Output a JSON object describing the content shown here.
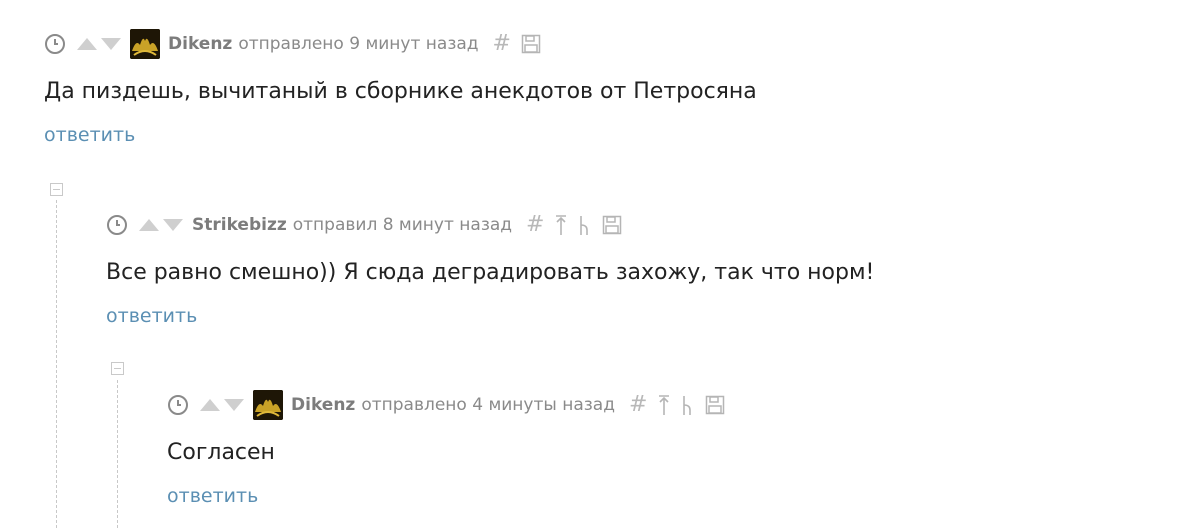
{
  "comments": [
    {
      "author": "Dikenz",
      "meta": "отправлено 9 минут назад",
      "text": "Да пиздешь, вычитаный в сборнике анекдотов от Петросяна",
      "reply": "ответить",
      "has_avatar": true,
      "icons": [
        "clock-icon",
        "upvote-icon",
        "downvote-icon",
        "hash-icon",
        "save-icon"
      ]
    },
    {
      "author": "Strikebizz",
      "meta": "отправил 8 минут назад",
      "text": "Все равно смешно)) Я сюда деградировать захожу, так что норм!",
      "reply": "ответить",
      "has_avatar": false,
      "icons": [
        "clock-icon",
        "upvote-icon",
        "downvote-icon",
        "hash-icon",
        "parent-icon",
        "thread-icon",
        "save-icon"
      ]
    },
    {
      "author": "Dikenz",
      "meta": "отправлено 4 минуты назад",
      "text": "Согласен",
      "reply": "ответить",
      "has_avatar": true,
      "icons": [
        "clock-icon",
        "upvote-icon",
        "downvote-icon",
        "hash-icon",
        "parent-icon",
        "thread-icon",
        "save-icon"
      ]
    }
  ],
  "colors": {
    "link": "#5b8fb3",
    "meta": "#8a8a8a",
    "text": "#222222"
  }
}
